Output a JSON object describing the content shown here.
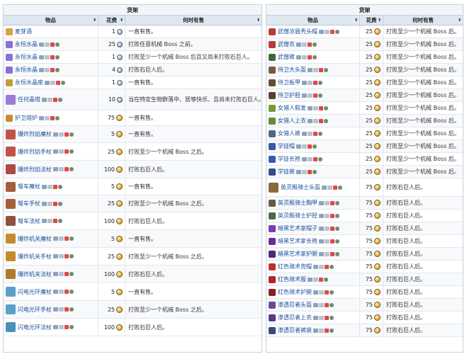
{
  "left": {
    "caption": "货架",
    "headers": {
      "item": "物品",
      "price": "花费",
      "when": "何时有售"
    },
    "rows": [
      {
        "name": "麦芽酒",
        "icon": "ale-icon",
        "color": "#d9a23a",
        "platforms": false,
        "price": "1",
        "coin": "platinum",
        "when": "一直有售。",
        "h": 18
      },
      {
        "name": "永恒水晶",
        "icon": "crystal-icon",
        "color": "#8a6fd6",
        "platforms": true,
        "price": "25",
        "coin": "platinum",
        "when": "打败任意机械 Boss 之前。",
        "h": 18
      },
      {
        "name": "永恒水晶",
        "icon": "crystal-icon",
        "color": "#8a6fd6",
        "platforms": true,
        "price": "1",
        "coin": "platinum",
        "when": "打败至少一个机械 Boss 后且又尚未打败石巨人。",
        "h": 18
      },
      {
        "name": "永恒水晶",
        "icon": "crystal-icon",
        "color": "#8a6fd6",
        "platforms": true,
        "price": "4",
        "coin": "platinum",
        "when": "打败石巨人后。",
        "h": 18
      },
      {
        "name": "永恒水晶座",
        "icon": "crystal-stand-icon",
        "color": "#c59a3c",
        "platforms": true,
        "price": "1",
        "coin": "platinum",
        "when": "一直有售。",
        "h": 18
      },
      {
        "name": "任何晶塔",
        "icon": "pylon-icon",
        "color": "#9f7ad8",
        "platforms": true,
        "price": "10",
        "coin": "platinum",
        "when": "当在特定生物群落中、居够快乐、且尚未打败石巨人。",
        "h": 30
      },
      {
        "name": "护卫熔炉",
        "icon": "defenders-forge-icon",
        "color": "#c98a2e",
        "platforms": true,
        "price": "75",
        "coin": "gold",
        "when": "一直有售。",
        "h": 22
      },
      {
        "name": "爆炸烈焰魔杖",
        "icon": "flameburst-staff-icon",
        "color": "#c0544a",
        "platforms": true,
        "price": "5",
        "coin": "gold",
        "when": "一直有售。",
        "h": 24
      },
      {
        "name": "爆炸烈焰手杖",
        "icon": "flameburst-staff-icon",
        "color": "#c0544a",
        "platforms": true,
        "price": "25",
        "coin": "gold",
        "when": "打败至少一个机械 Boss 之后。",
        "h": 25
      },
      {
        "name": "爆炸烈焰法杖",
        "icon": "flameburst-staff-icon",
        "color": "#b14742",
        "platforms": true,
        "price": "100",
        "coin": "gold",
        "when": "打败石巨人后。",
        "h": 25
      },
      {
        "name": "弩车魔杖",
        "icon": "ballista-staff-icon",
        "color": "#a45f3a",
        "platforms": true,
        "price": "5",
        "coin": "gold",
        "when": "一直有售。",
        "h": 24
      },
      {
        "name": "弩车手杖",
        "icon": "ballista-staff-icon",
        "color": "#a45f3a",
        "platforms": true,
        "price": "25",
        "coin": "gold",
        "when": "打败至少一个机械 Boss 之后。",
        "h": 24
      },
      {
        "name": "弩车法杖",
        "icon": "ballista-staff-icon",
        "color": "#93523a",
        "platforms": true,
        "price": "100",
        "coin": "gold",
        "when": "打败石巨人后。",
        "h": 25
      },
      {
        "name": "爆炸机关魔杖",
        "icon": "explosive-trap-staff-icon",
        "color": "#c88a2e",
        "platforms": true,
        "price": "5",
        "coin": "gold",
        "when": "一直有售。",
        "h": 25
      },
      {
        "name": "爆炸机关手杖",
        "icon": "explosive-trap-staff-icon",
        "color": "#c88a2e",
        "platforms": true,
        "price": "25",
        "coin": "gold",
        "when": "打败至少一个机械 Boss 之后。",
        "h": 25
      },
      {
        "name": "爆炸机关法杖",
        "icon": "explosive-trap-staff-icon",
        "color": "#b37a26",
        "platforms": true,
        "price": "100",
        "coin": "gold",
        "when": "打败石巨人后。",
        "h": 25
      },
      {
        "name": "闪电光环魔杖",
        "icon": "lightning-aura-icon",
        "color": "#5aa0c8",
        "platforms": true,
        "price": "5",
        "coin": "gold",
        "when": "一直有售。",
        "h": 25
      },
      {
        "name": "闪电光环手杖",
        "icon": "lightning-aura-icon",
        "color": "#5aa0c8",
        "platforms": true,
        "price": "25",
        "coin": "gold",
        "when": "打败至少一个机械 Boss 之后。",
        "h": 25
      },
      {
        "name": "闪电光环法杖",
        "icon": "lightning-aura-icon",
        "color": "#4c8fb8",
        "platforms": true,
        "price": "100",
        "coin": "gold",
        "when": "打败石巨人后。",
        "h": 25
      }
    ]
  },
  "right": {
    "caption": "货架",
    "headers": {
      "item": "物品",
      "price": "花费",
      "when": "何时有售"
    },
    "rows": [
      {
        "name": "武僧浓眉秃头帽",
        "icon": "monk-helmet-icon",
        "color": "#b83a3a",
        "price": "25",
        "when": "打败至少一个机械 Boss 后。",
        "h": 18
      },
      {
        "name": "武僧衣",
        "icon": "monk-shirt-icon",
        "color": "#b83a3a",
        "price": "25",
        "when": "打败至少一个机械 Boss 后。",
        "h": 18
      },
      {
        "name": "武僧裤",
        "icon": "monk-pants-icon",
        "color": "#3b6a3a",
        "price": "25",
        "when": "打败至少一个机械 Boss 后。",
        "h": 18
      },
      {
        "name": "侍卫大头盔",
        "icon": "squire-helmet-icon",
        "color": "#7a5a3a",
        "price": "25",
        "when": "打败至少一个机械 Boss 后。",
        "h": 18
      },
      {
        "name": "侍卫板甲",
        "icon": "squire-plating-icon",
        "color": "#6a4a30",
        "price": "25",
        "when": "打败至少一个机械 Boss 后。",
        "h": 18
      },
      {
        "name": "侍卫护胫",
        "icon": "squire-greaves-icon",
        "color": "#5a4030",
        "price": "25",
        "when": "打败至少一个机械 Boss 后。",
        "h": 18
      },
      {
        "name": "女猎人假发",
        "icon": "huntress-wig-icon",
        "color": "#7a9a3a",
        "price": "25",
        "when": "打败至少一个机械 Boss 后。",
        "h": 18
      },
      {
        "name": "女猎人上衣",
        "icon": "huntress-jerkin-icon",
        "color": "#6a8a30",
        "price": "25",
        "when": "打败至少一个机械 Boss 后。",
        "h": 18
      },
      {
        "name": "女猎人裤",
        "icon": "huntress-pants-icon",
        "color": "#4a6a8a",
        "price": "25",
        "when": "打败至少一个机械 Boss 后。",
        "h": 18
      },
      {
        "name": "学徒帽",
        "icon": "apprentice-hat-icon",
        "color": "#3a5aa8",
        "price": "25",
        "when": "打败至少一个机械 Boss 后。",
        "h": 18
      },
      {
        "name": "学徒长袍",
        "icon": "apprentice-robe-icon",
        "color": "#3a5aa8",
        "price": "25",
        "when": "打败至少一个机械 Boss 后。",
        "h": 18
      },
      {
        "name": "学徒裤",
        "icon": "apprentice-trousers-icon",
        "color": "#3a4a88",
        "price": "25",
        "when": "打败至少一个机械 Boss 后。",
        "h": 18
      },
      {
        "name": "英灵殿骑士头盔",
        "icon": "valhalla-helm-icon",
        "color": "#8a6a3a",
        "price": "75",
        "when": "打败石巨人后。",
        "h": 26
      },
      {
        "name": "英灵殿骑士胸甲",
        "icon": "valhalla-breastplate-icon",
        "color": "#6a5a40",
        "price": "75",
        "when": "打败石巨人后。",
        "h": 18
      },
      {
        "name": "英灵殿骑士护胫",
        "icon": "valhalla-greaves-icon",
        "color": "#4a6a4a",
        "price": "75",
        "when": "打败石巨人后。",
        "h": 18
      },
      {
        "name": "暗黑艺术家帽子",
        "icon": "dark-artist-hat-icon",
        "color": "#7a3ab0",
        "price": "75",
        "when": "打败石巨人后。",
        "h": 18
      },
      {
        "name": "暗黑艺术家长袍",
        "icon": "dark-artist-robes-icon",
        "color": "#6a2a9a",
        "price": "75",
        "when": "打败石巨人后。",
        "h": 18
      },
      {
        "name": "暗黑艺术家护腿",
        "icon": "dark-artist-leggings-icon",
        "color": "#4a2a7a",
        "price": "75",
        "when": "打败石巨人后。",
        "h": 18
      },
      {
        "name": "红色骑术兜帽",
        "icon": "red-riding-hood-icon",
        "color": "#c03030",
        "price": "75",
        "when": "打败石巨人后。",
        "h": 18
      },
      {
        "name": "红色骑术服",
        "icon": "red-riding-dress-icon",
        "color": "#b02828",
        "price": "75",
        "when": "打败石巨人后。",
        "h": 18
      },
      {
        "name": "红色骑术护腿",
        "icon": "red-riding-leggings-icon",
        "color": "#8a2020",
        "price": "75",
        "when": "打败石巨人后。",
        "h": 18
      },
      {
        "name": "渗透忍者头盔",
        "icon": "shinobi-helmet-icon",
        "color": "#6a4a9a",
        "price": "75",
        "when": "打败石巨人后。",
        "h": 18
      },
      {
        "name": "渗透忍者上衣",
        "icon": "shinobi-tunic-icon",
        "color": "#5a3a8a",
        "price": "75",
        "when": "打败石巨人后。",
        "h": 18
      },
      {
        "name": "渗透忍者裤装",
        "icon": "shinobi-pants-icon",
        "color": "#3a4a7a",
        "price": "75",
        "when": "打败石巨人后。",
        "h": 18
      }
    ]
  },
  "colors": {
    "header_bg": "#dfe8f1",
    "caption_bg": "#f2f6fa",
    "border": "#c5d0dc",
    "link": "#1a4f9c"
  }
}
